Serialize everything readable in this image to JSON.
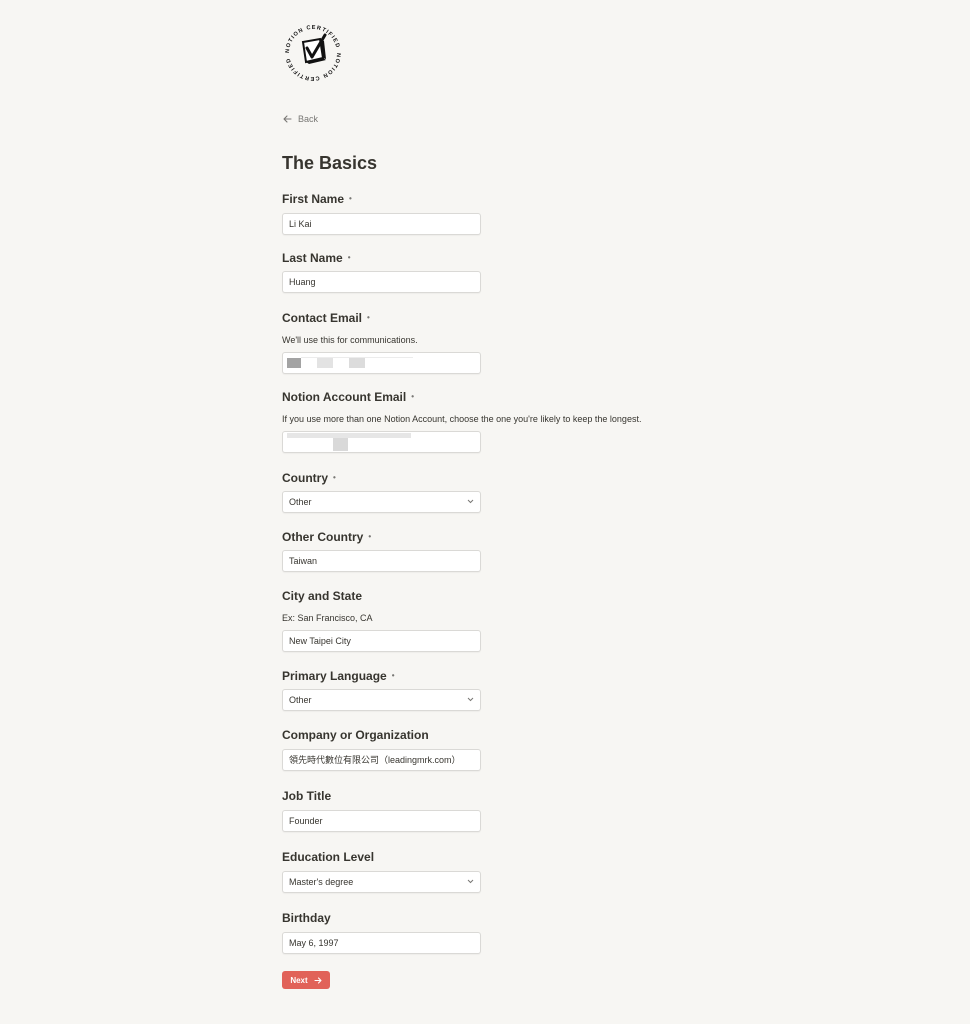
{
  "logo": {
    "text": "NOTION CERTIFIED",
    "icon": "checkbox-seal-icon"
  },
  "nav": {
    "back_label": "Back"
  },
  "form": {
    "title": "The Basics",
    "required_mark": "•",
    "fields": {
      "first_name": {
        "label": "First Name",
        "value": "Li Kai"
      },
      "last_name": {
        "label": "Last Name",
        "value": "Huang"
      },
      "contact_email": {
        "label": "Contact Email",
        "help": "We'll use this for communications.",
        "value": ""
      },
      "notion_email": {
        "label": "Notion Account Email",
        "help": "If you use more than one Notion Account, choose the one you're likely to keep the longest.",
        "value": ""
      },
      "country": {
        "label": "Country",
        "value": "Other"
      },
      "other_country": {
        "label": "Other Country",
        "value": "Taiwan"
      },
      "city_state": {
        "label": "City and State",
        "help": "Ex: San Francisco, CA",
        "value": "New Taipei City"
      },
      "primary_language": {
        "label": "Primary Language",
        "value": "Other"
      },
      "company": {
        "label": "Company or Organization",
        "value": "領先時代數位有限公司（leadingmrk.com）"
      },
      "job_title": {
        "label": "Job Title",
        "value": "Founder"
      },
      "education": {
        "label": "Education Level",
        "value": "Master's degree"
      },
      "birthday": {
        "label": "Birthday",
        "value": "May 6, 1997"
      }
    },
    "next_label": "Next"
  },
  "colors": {
    "background": "#f7f6f3",
    "text": "#37352f",
    "muted": "#787774",
    "accent": "#e16259"
  }
}
